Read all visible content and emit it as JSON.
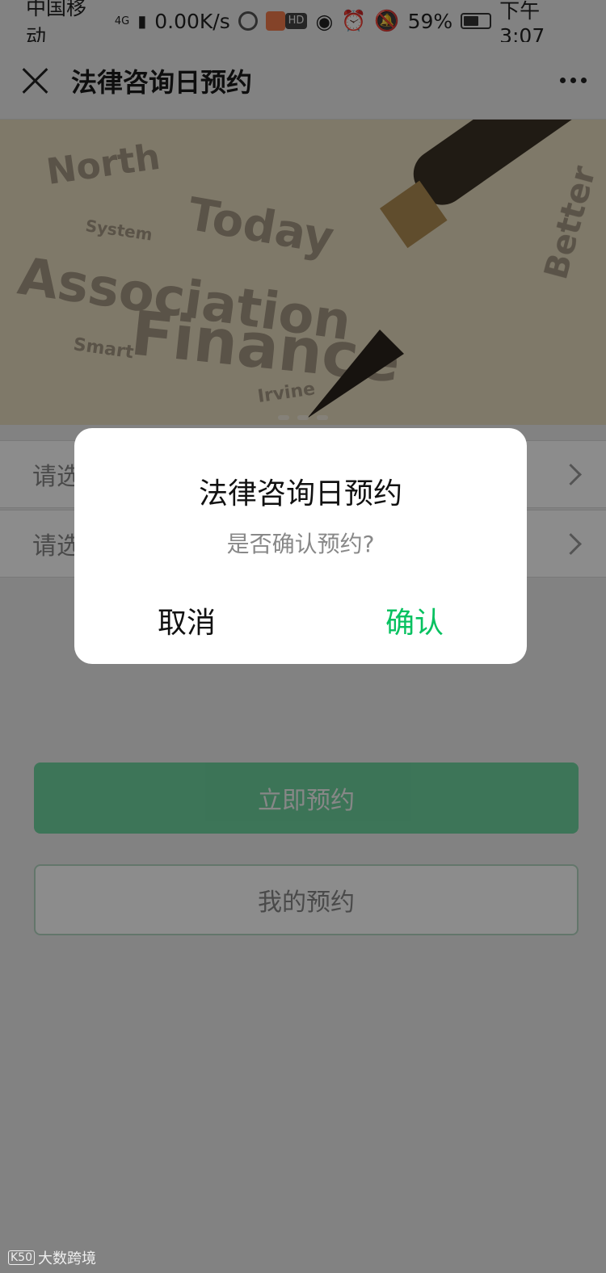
{
  "status_bar": {
    "carrier": "中国移动",
    "network": "4G",
    "speed": "0.00K/s",
    "hd_label": "HD",
    "battery_percent": "59%",
    "battery_level": 0.59,
    "time": "下午3:07"
  },
  "navbar": {
    "title": "法律咨询日预约"
  },
  "banner": {
    "words": [
      "Association",
      "Finance",
      "Today",
      "Smart",
      "System",
      "Irvine",
      "North",
      "Better"
    ]
  },
  "form": {
    "select1_placeholder": "请选",
    "select2_placeholder": "请选"
  },
  "buttons": {
    "book_now": "立即预约",
    "my_bookings": "我的预约"
  },
  "dialog": {
    "title": "法律咨询日预约",
    "message": "是否确认预约?",
    "cancel_label": "取消",
    "confirm_label": "确认"
  },
  "colors": {
    "accent": "#07c160",
    "mask": "rgba(0,0,0,0.45)"
  },
  "watermark": {
    "logo": "K50",
    "text": "大数跨境"
  }
}
